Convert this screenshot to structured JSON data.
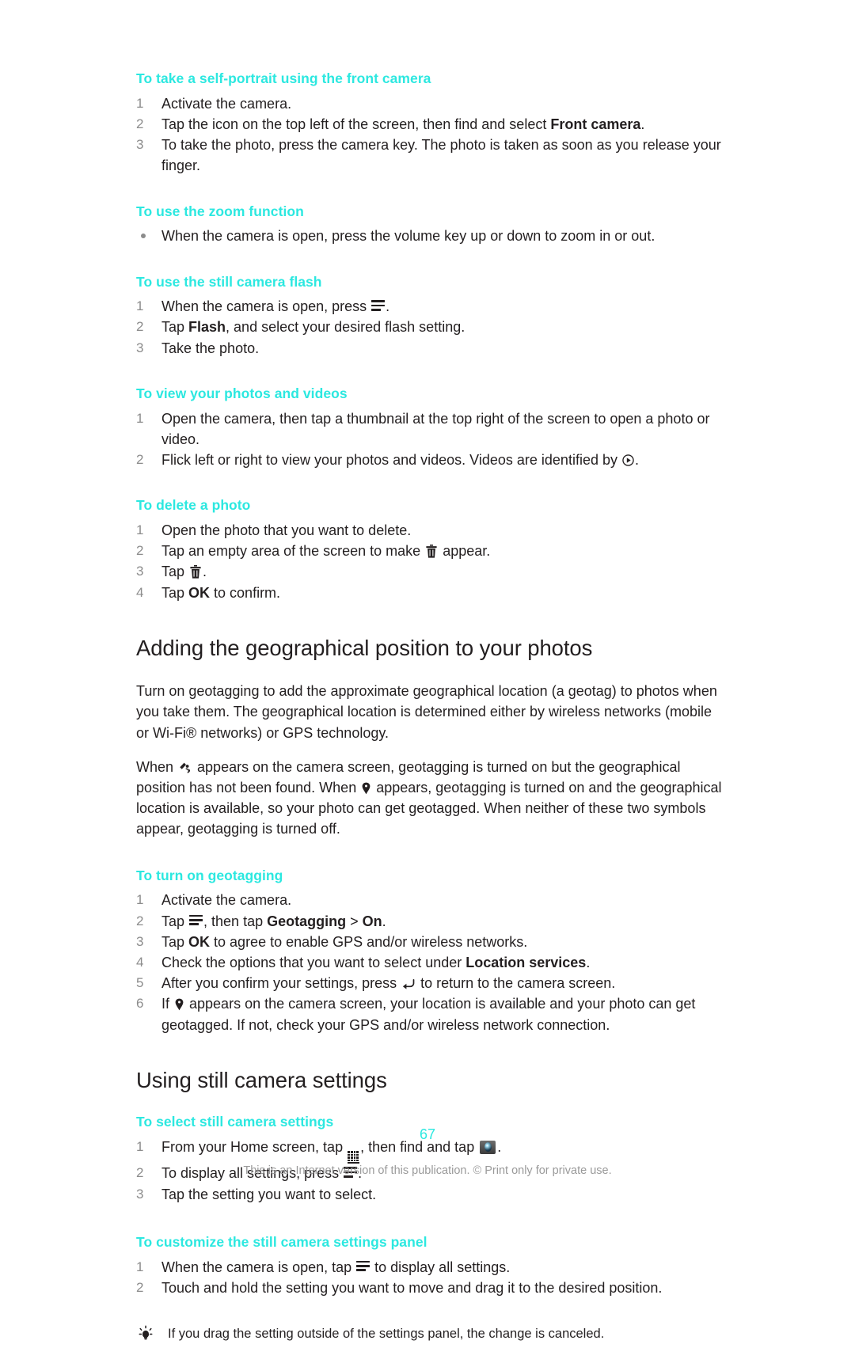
{
  "document": {
    "page_number": "67",
    "footer_note": "This is an Internet version of this publication. © Print only for private use.",
    "heading_color": "#2ce8e0",
    "body_color": "#231f20"
  },
  "sections": {
    "self_portrait": {
      "title": "To take a self-portrait using the front camera",
      "steps": [
        {
          "num": "1",
          "parts": [
            {
              "t": "text",
              "v": "Activate the camera."
            }
          ]
        },
        {
          "num": "2",
          "parts": [
            {
              "t": "text",
              "v": "Tap the icon on the top left of the screen, then find and select "
            },
            {
              "t": "bold",
              "v": "Front camera"
            },
            {
              "t": "text",
              "v": "."
            }
          ]
        },
        {
          "num": "3",
          "parts": [
            {
              "t": "text",
              "v": "To take the photo, press the camera key. The photo is taken as soon as you release your finger."
            }
          ]
        }
      ]
    },
    "zoom_function": {
      "title": "To use the zoom function",
      "bullets": [
        {
          "parts": [
            {
              "t": "text",
              "v": "When the camera is open, press the volume key up or down to zoom in or out."
            }
          ]
        }
      ]
    },
    "still_flash": {
      "title": "To use the still camera flash",
      "steps": [
        {
          "num": "1",
          "parts": [
            {
              "t": "text",
              "v": "When the camera is open, press "
            },
            {
              "t": "icon",
              "v": "menu-icon"
            },
            {
              "t": "text",
              "v": "."
            }
          ]
        },
        {
          "num": "2",
          "parts": [
            {
              "t": "text",
              "v": "Tap "
            },
            {
              "t": "bold",
              "v": "Flash"
            },
            {
              "t": "text",
              "v": ", and select your desired flash setting."
            }
          ]
        },
        {
          "num": "3",
          "parts": [
            {
              "t": "text",
              "v": "Take the photo."
            }
          ]
        }
      ]
    },
    "view_photos": {
      "title": "To view your photos and videos",
      "steps": [
        {
          "num": "1",
          "parts": [
            {
              "t": "text",
              "v": "Open the camera, then tap a thumbnail at the top right of the screen to open a photo or video."
            }
          ]
        },
        {
          "num": "2",
          "parts": [
            {
              "t": "text",
              "v": "Flick left or right to view your photos and videos. Videos are identified by "
            },
            {
              "t": "icon",
              "v": "play-icon"
            },
            {
              "t": "text",
              "v": "."
            }
          ]
        }
      ]
    },
    "delete_photo": {
      "title": "To delete a photo",
      "steps": [
        {
          "num": "1",
          "parts": [
            {
              "t": "text",
              "v": "Open the photo that you want to delete."
            }
          ]
        },
        {
          "num": "2",
          "parts": [
            {
              "t": "text",
              "v": "Tap an empty area of the screen to make "
            },
            {
              "t": "icon",
              "v": "trash-icon"
            },
            {
              "t": "text",
              "v": " appear."
            }
          ]
        },
        {
          "num": "3",
          "parts": [
            {
              "t": "text",
              "v": "Tap "
            },
            {
              "t": "icon",
              "v": "trash-icon"
            },
            {
              "t": "text",
              "v": "."
            }
          ]
        },
        {
          "num": "4",
          "parts": [
            {
              "t": "text",
              "v": "Tap "
            },
            {
              "t": "bold",
              "v": "OK"
            },
            {
              "t": "text",
              "v": " to confirm."
            }
          ]
        }
      ]
    },
    "geo_position": {
      "heading": "Adding the geographical position to your photos",
      "paragraph_1": "Turn on geotagging to add the approximate geographical location (a geotag) to photos when you take them. The geographical location is determined either by wireless networks (mobile or Wi-Fi® networks) or GPS technology.",
      "paragraph_2_parts": [
        {
          "t": "text",
          "v": "When "
        },
        {
          "t": "icon",
          "v": "geotag-searching-icon"
        },
        {
          "t": "text",
          "v": " appears on the camera screen, geotagging is turned on but the geographical position has not been found. When "
        },
        {
          "t": "icon",
          "v": "location-pin-icon"
        },
        {
          "t": "text",
          "v": " appears, geotagging is turned on and the geographical location is available, so your photo can get geotagged. When neither of these two symbols appear, geotagging is turned off."
        }
      ]
    },
    "turn_on_geotagging": {
      "title": "To turn on geotagging",
      "steps": [
        {
          "num": "1",
          "parts": [
            {
              "t": "text",
              "v": "Activate the camera."
            }
          ]
        },
        {
          "num": "2",
          "parts": [
            {
              "t": "text",
              "v": "Tap "
            },
            {
              "t": "icon",
              "v": "menu-icon"
            },
            {
              "t": "text",
              "v": ", then tap "
            },
            {
              "t": "bold",
              "v": "Geotagging"
            },
            {
              "t": "text",
              "v": " > "
            },
            {
              "t": "bold",
              "v": "On"
            },
            {
              "t": "text",
              "v": "."
            }
          ]
        },
        {
          "num": "3",
          "parts": [
            {
              "t": "text",
              "v": "Tap "
            },
            {
              "t": "bold",
              "v": "OK"
            },
            {
              "t": "text",
              "v": " to agree to enable GPS and/or wireless networks."
            }
          ]
        },
        {
          "num": "4",
          "parts": [
            {
              "t": "text",
              "v": "Check the options that you want to select under "
            },
            {
              "t": "bold",
              "v": "Location services"
            },
            {
              "t": "text",
              "v": "."
            }
          ]
        },
        {
          "num": "5",
          "parts": [
            {
              "t": "text",
              "v": "After you confirm your settings, press "
            },
            {
              "t": "icon",
              "v": "back-arrow-icon"
            },
            {
              "t": "text",
              "v": " to return to the camera screen."
            }
          ]
        },
        {
          "num": "6",
          "parts": [
            {
              "t": "text",
              "v": "If "
            },
            {
              "t": "icon",
              "v": "location-pin-icon"
            },
            {
              "t": "text",
              "v": " appears on the camera screen, your location is available and your photo can get geotagged. If not, check your GPS and/or wireless network connection."
            }
          ]
        }
      ]
    },
    "still_camera_settings": {
      "heading": "Using still camera settings",
      "select_settings": {
        "title": "To select still camera settings",
        "steps": [
          {
            "num": "1",
            "parts": [
              {
                "t": "text",
                "v": "From your Home screen, tap "
              },
              {
                "t": "icon",
                "v": "app-grid-icon"
              },
              {
                "t": "text",
                "v": ", then find and tap "
              },
              {
                "t": "icon",
                "v": "camera-icon"
              },
              {
                "t": "text",
                "v": "."
              }
            ]
          },
          {
            "num": "2",
            "parts": [
              {
                "t": "text",
                "v": "To display all settings, press "
              },
              {
                "t": "icon",
                "v": "menu-icon"
              },
              {
                "t": "text",
                "v": "."
              }
            ]
          },
          {
            "num": "3",
            "parts": [
              {
                "t": "text",
                "v": "Tap the setting you want to select."
              }
            ]
          }
        ]
      },
      "customize_panel": {
        "title": "To customize the still camera settings panel",
        "steps": [
          {
            "num": "1",
            "parts": [
              {
                "t": "text",
                "v": "When the camera is open, tap "
              },
              {
                "t": "icon",
                "v": "menu-icon"
              },
              {
                "t": "text",
                "v": " to display all settings."
              }
            ]
          },
          {
            "num": "2",
            "parts": [
              {
                "t": "text",
                "v": "Touch and hold the setting you want to move and drag it to the desired position."
              }
            ]
          }
        ],
        "tip": "If you drag the setting outside of the settings panel, the change is canceled."
      }
    }
  }
}
